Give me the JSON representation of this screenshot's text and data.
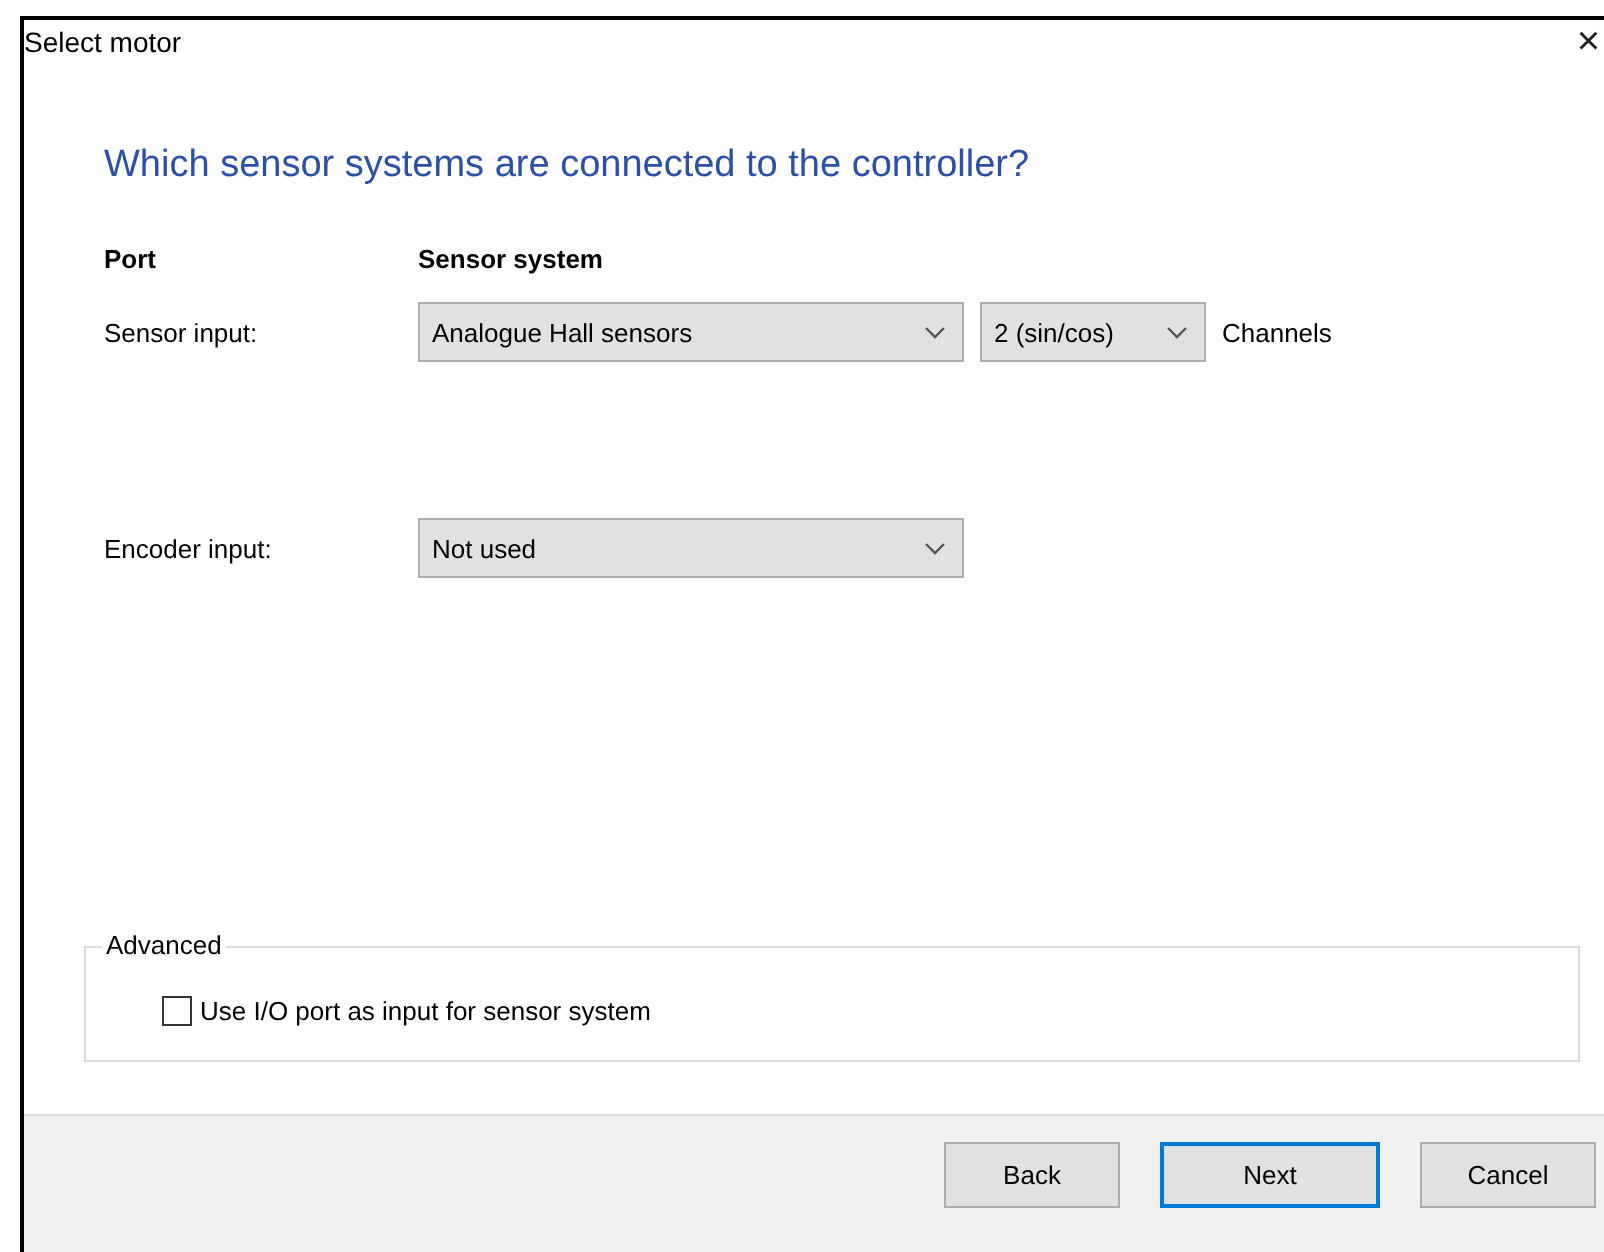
{
  "window": {
    "title": "Select motor",
    "close": "×"
  },
  "heading": "Which sensor systems are connected to the controller?",
  "columns": [
    "Port",
    "Sensor system"
  ],
  "rows": [
    {
      "label": "Sensor input:",
      "selects": [
        "Analogue Hall sensors",
        "2 (sin/cos)"
      ],
      "suffix": "Channels"
    },
    {
      "label": "Encoder input:",
      "selects": [
        "Not used"
      ]
    }
  ],
  "advanced": {
    "title": "Advanced",
    "checkbox": {
      "label": "Use I/O port as input for sensor system",
      "checked": false
    }
  },
  "buttons": [
    {
      "label": "Back",
      "default": false
    },
    {
      "label": "Next",
      "default": true
    },
    {
      "label": "Cancel",
      "default": false
    }
  ]
}
